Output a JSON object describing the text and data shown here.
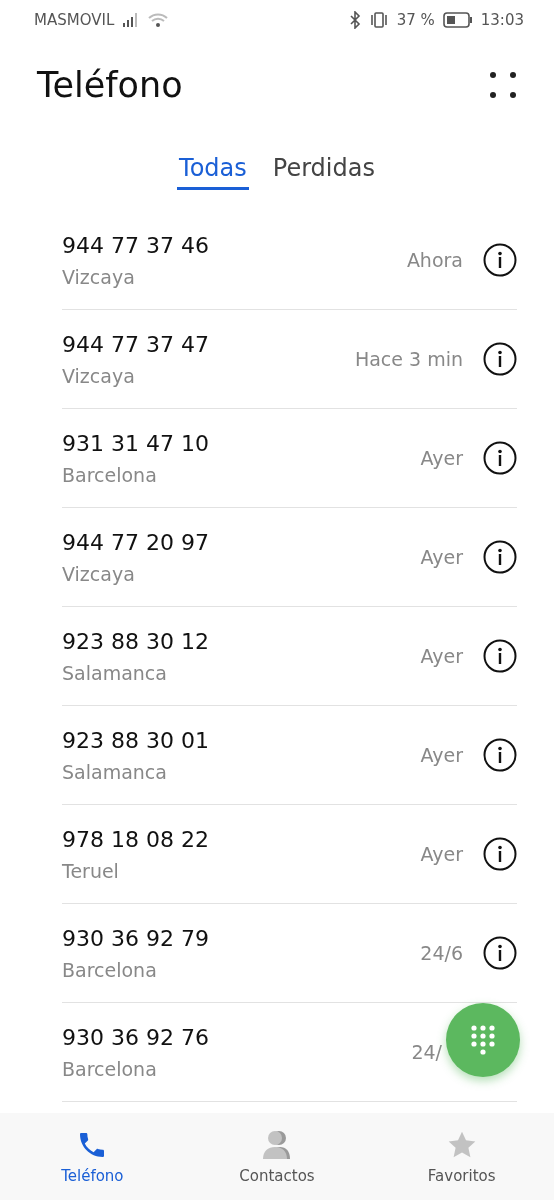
{
  "status_bar": {
    "carrier": "MASMOVIL",
    "battery_text": "37 %",
    "time": "13:03"
  },
  "header": {
    "title": "Teléfono"
  },
  "tabs": [
    {
      "label": "Todas",
      "selected": true
    },
    {
      "label": "Perdidas",
      "selected": false
    }
  ],
  "calls": [
    {
      "number": "944 77 37 46",
      "location": "Vizcaya",
      "time": "Ahora"
    },
    {
      "number": "944 77 37 47",
      "location": "Vizcaya",
      "time": "Hace 3 min"
    },
    {
      "number": "931 31 47 10",
      "location": "Barcelona",
      "time": "Ayer"
    },
    {
      "number": "944 77 20 97",
      "location": "Vizcaya",
      "time": "Ayer"
    },
    {
      "number": "923 88 30 12",
      "location": "Salamanca",
      "time": "Ayer"
    },
    {
      "number": "923 88 30 01",
      "location": "Salamanca",
      "time": "Ayer"
    },
    {
      "number": "978 18 08 22",
      "location": "Teruel",
      "time": "Ayer"
    },
    {
      "number": "930 36 92 79",
      "location": "Barcelona",
      "time": "24/6"
    },
    {
      "number": "930 36 92 76",
      "location": "Barcelona",
      "time": "24/"
    }
  ],
  "bottom_nav": [
    {
      "label": "Teléfono",
      "kind": "phone",
      "selected": true
    },
    {
      "label": "Contactos",
      "kind": "contacts",
      "selected": false
    },
    {
      "label": "Favoritos",
      "kind": "star",
      "selected": false
    }
  ]
}
